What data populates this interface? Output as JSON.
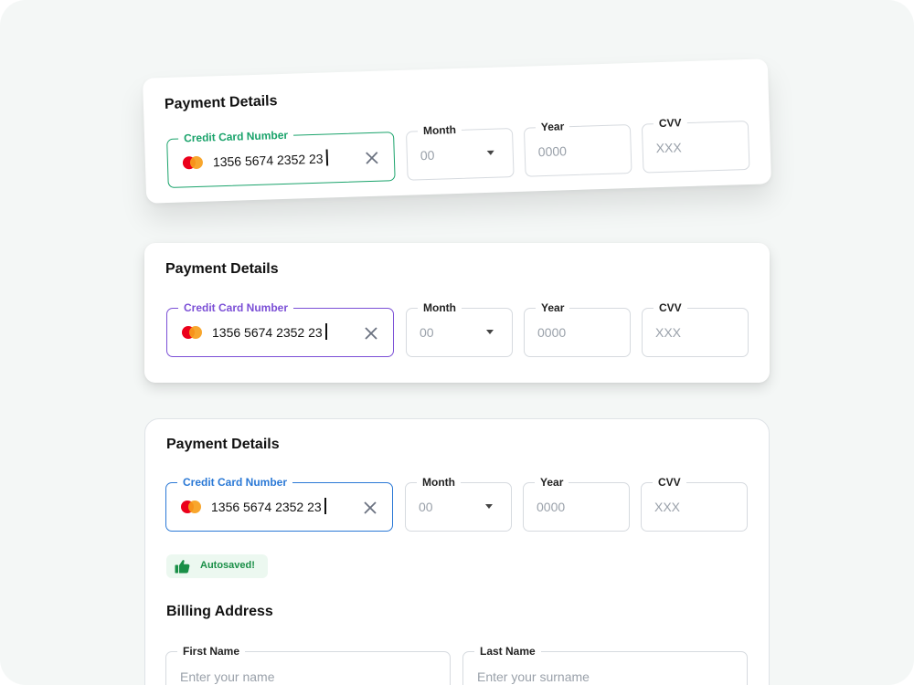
{
  "cards": [
    {
      "title": "Payment Details",
      "card_field": {
        "label": "Credit Card Number",
        "value": "1356 5674 2352 23",
        "accent": "#1aa36b"
      },
      "month": {
        "label": "Month",
        "value": "00"
      },
      "year": {
        "label": "Year",
        "placeholder": "0000"
      },
      "cvv": {
        "label": "CVV",
        "placeholder": "XXX"
      }
    },
    {
      "title": "Payment Details",
      "card_field": {
        "label": "Credit Card Number",
        "value": "1356 5674 2352 23",
        "accent": "#7b4fd6"
      },
      "month": {
        "label": "Month",
        "value": "00"
      },
      "year": {
        "label": "Year",
        "placeholder": "0000"
      },
      "cvv": {
        "label": "CVV",
        "placeholder": "XXX"
      }
    },
    {
      "title": "Payment Details",
      "card_field": {
        "label": "Credit Card Number",
        "value": "1356 5674 2352 23",
        "accent": "#2b79d6"
      },
      "month": {
        "label": "Month",
        "value": "00"
      },
      "year": {
        "label": "Year",
        "placeholder": "0000"
      },
      "cvv": {
        "label": "CVV",
        "placeholder": "XXX"
      },
      "autosave": {
        "label": "Autosaved!",
        "color": "#1a8f47",
        "background": "#ecf8f0"
      },
      "billing": {
        "title": "Billing Address",
        "first_name": {
          "label": "First Name",
          "placeholder": "Enter your name"
        },
        "last_name": {
          "label": "Last Name",
          "placeholder": "Enter your surname"
        }
      }
    }
  ],
  "icons": {
    "card_brand": "mastercard-icon",
    "clear": "close-icon",
    "dropdown": "caret-down-icon",
    "autosave": "thumbs-up-icon"
  }
}
